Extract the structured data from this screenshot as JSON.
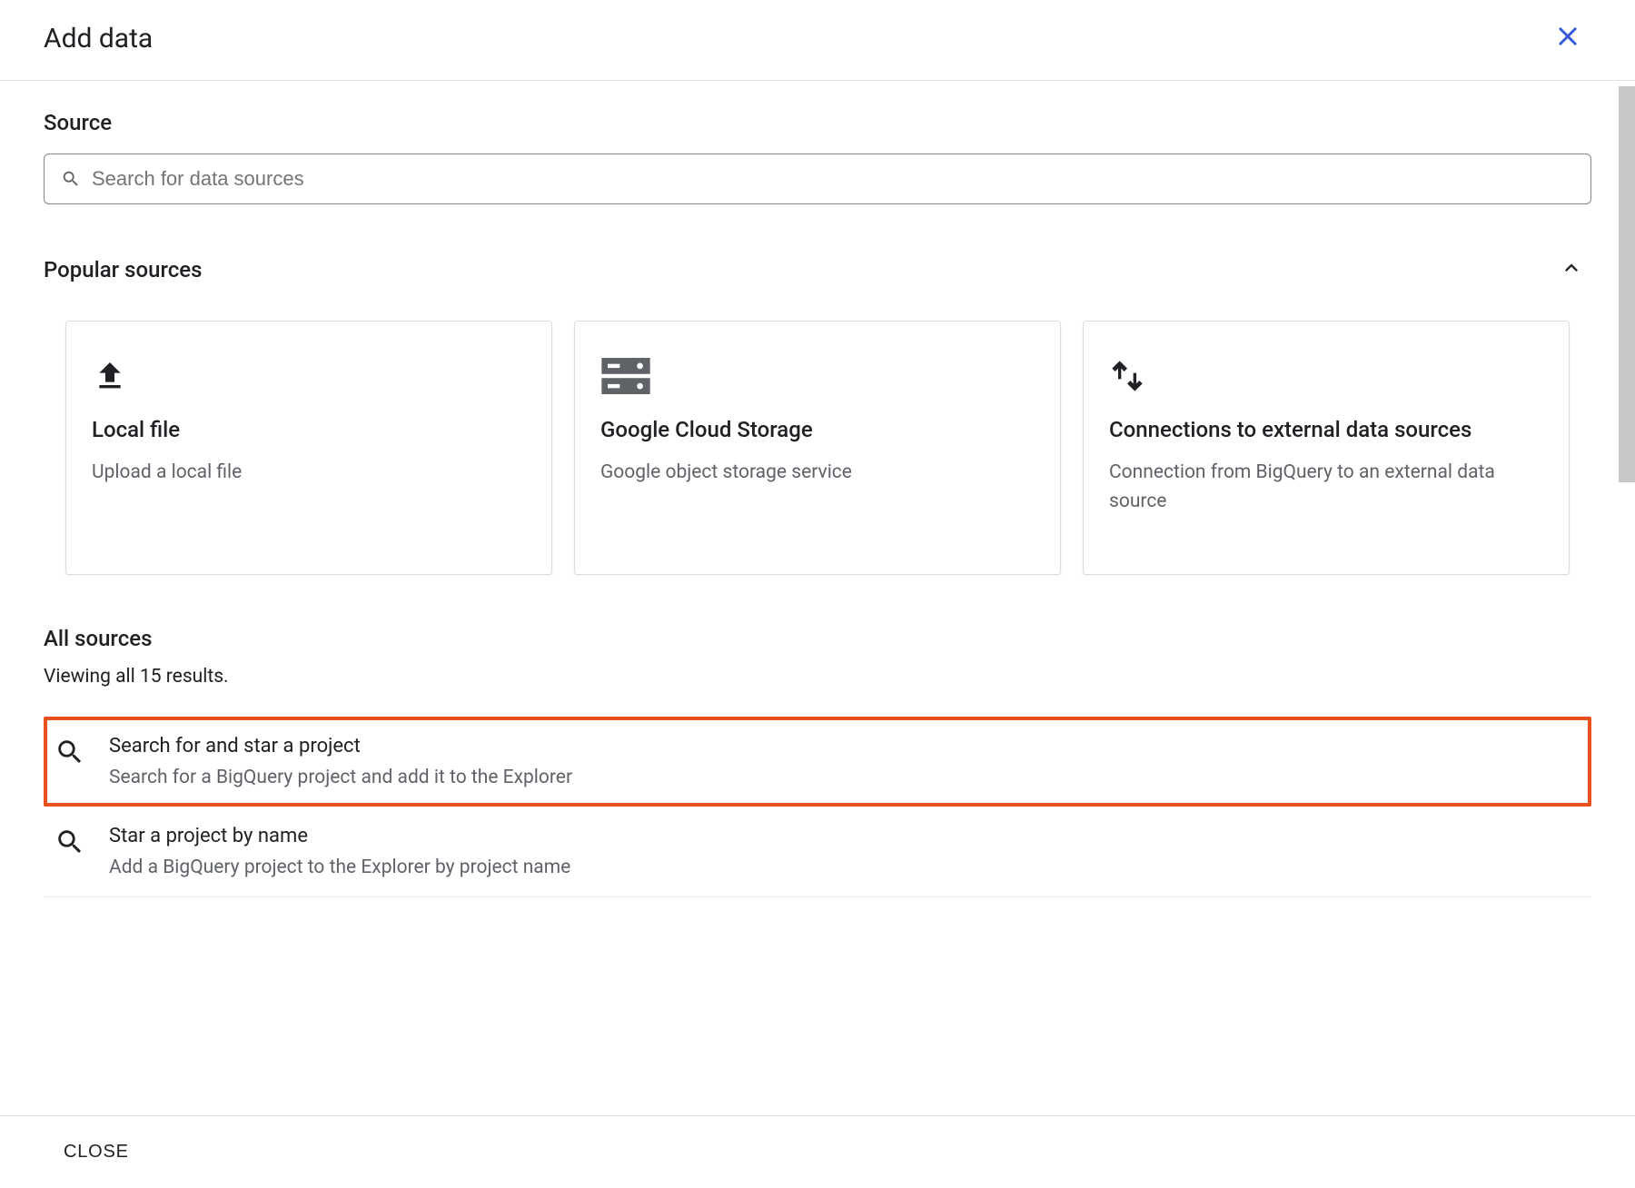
{
  "header": {
    "title": "Add data"
  },
  "source": {
    "label": "Source",
    "search_placeholder": "Search for data sources"
  },
  "popular": {
    "label": "Popular sources",
    "cards": [
      {
        "title": "Local file",
        "desc": "Upload a local file",
        "icon": "upload"
      },
      {
        "title": "Google Cloud Storage",
        "desc": "Google object storage service",
        "icon": "storage"
      },
      {
        "title": "Connections to external data sources",
        "desc": "Connection from BigQuery to an external data source",
        "icon": "exchange"
      }
    ]
  },
  "all_sources": {
    "label": "All sources",
    "results_text": "Viewing all 15 results.",
    "items": [
      {
        "title": "Search for and star a project",
        "desc": "Search for a BigQuery project and add it to the Explorer",
        "icon": "search",
        "highlighted": true
      },
      {
        "title": "Star a project by name",
        "desc": "Add a BigQuery project to the Explorer by project name",
        "icon": "search",
        "highlighted": false
      }
    ]
  },
  "footer": {
    "close_label": "CLOSE"
  }
}
